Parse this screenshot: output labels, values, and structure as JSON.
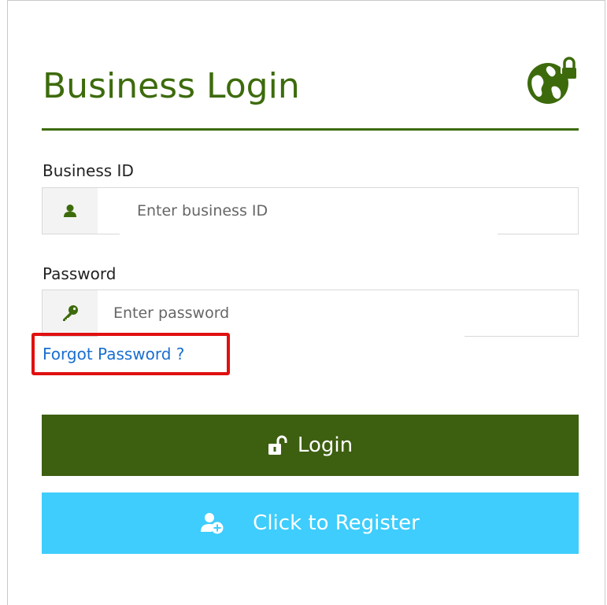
{
  "form": {
    "title": "Business Login",
    "business_id": {
      "label": "Business ID",
      "placeholder": "Enter business ID",
      "icon": "user-icon"
    },
    "password": {
      "label": "Password",
      "placeholder": "Enter password",
      "icon": "key-icon"
    },
    "forgot_password_label": "Forgot Password ?",
    "login_button_label": "Login",
    "register_button_label": "Click to Register"
  },
  "colors": {
    "brand_green": "#3d6b0c",
    "login_button": "#3d5f10",
    "register_button": "#3ecdfc",
    "link": "#1a6fd0",
    "highlight": "#e01010"
  },
  "icons": {
    "header": "globe-lock-icon",
    "login": "unlock-icon",
    "register": "add-user-icon"
  }
}
